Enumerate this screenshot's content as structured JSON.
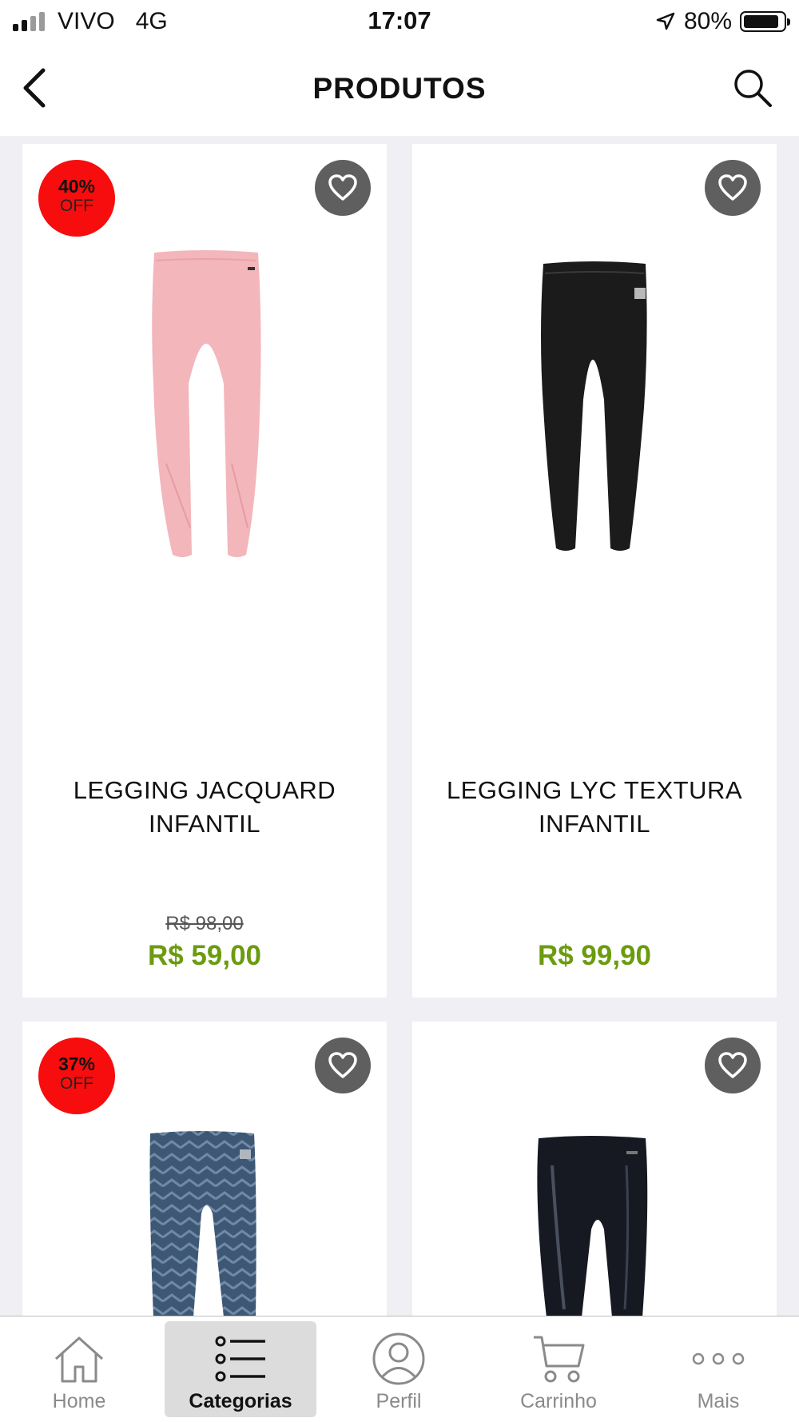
{
  "status_bar": {
    "carrier": "VIVO",
    "network": "4G",
    "time": "17:07",
    "battery": "80%"
  },
  "header": {
    "title": "PRODUTOS"
  },
  "products": [
    {
      "name": "LEGGING JACQUARD INFANTIL",
      "old_price": "R$ 98,00",
      "price": "R$ 59,00",
      "badge_pct": "40%",
      "badge_off": "OFF",
      "color": "#f4b8bd"
    },
    {
      "name": "LEGGING LYC TEXTURA INFANTIL",
      "old_price": "",
      "price": "R$ 99,90",
      "color": "#1a1a1a"
    },
    {
      "badge_pct": "37%",
      "badge_off": "OFF",
      "color": "#3c5572"
    },
    {
      "color": "#14161e"
    }
  ],
  "tabbar": {
    "home": "Home",
    "categorias": "Categorias",
    "perfil": "Perfil",
    "carrinho": "Carrinho",
    "mais": "Mais"
  }
}
